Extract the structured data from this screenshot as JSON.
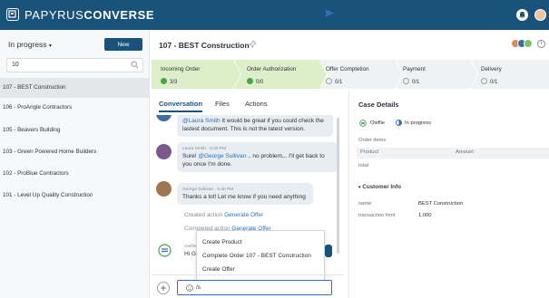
{
  "app": {
    "brand_light": "PAPYRUS",
    "brand_bold": "CONVERSE"
  },
  "colors": {
    "topbar": "#19537b",
    "accent": "#2e6fb5",
    "stage_done": "#dcefc9",
    "stage_todo": "#f0f1f2",
    "check": "#4aa54a"
  },
  "sidebar": {
    "status_filter": "In progress",
    "new_label": "New",
    "search_value": "10",
    "leads": [
      "107 - BEST Construction",
      "106 - ProAngle Contractors",
      "105 - Beavers Building",
      "103 - Green Powered Home Builders",
      "102 - ProBlue Contractors",
      "101 - Level Up Quality Construction"
    ]
  },
  "main": {
    "title": "107 - BEST Construction",
    "stages": [
      {
        "name": "Incoming Order",
        "count": "3/3",
        "done": true
      },
      {
        "name": "Order Authorization",
        "count": "0/0",
        "done": true
      },
      {
        "name": "Offer Completion",
        "count": "0/1",
        "done": false
      },
      {
        "name": "Payment",
        "count": "0/1",
        "done": false
      },
      {
        "name": "Delivery",
        "count": "0/1",
        "done": false
      }
    ],
    "tabs": [
      "Conversation",
      "Files",
      "Actions"
    ]
  },
  "conversation": {
    "msg1_cut_name": "@Laura Smith",
    "msg1_cut_rest": " It would be great if you could check the",
    "msg1_line2": "lastest document. This is not the latest version.",
    "msg2_meta": "Laura Smith · 6:40 PM",
    "msg2_pre": "Sure! ",
    "msg2_mention": "@George Sullivan",
    "msg2_post": " .. no problem,.. I'll get back to",
    "msg2_line2": "you once I'm done.",
    "msg3_meta": "George Sullivan · 6:40 PM",
    "msg3_text": "Thanks a lot! Let me know if you need anything",
    "action1_pre": "Created action ",
    "action1_link": "Generate Offer",
    "action2_pre": "Completed action ",
    "action2_link": "Generate Offer",
    "bot_meta": "Owflie",
    "bot_text": "Hi Ge"
  },
  "suggestions": [
    "Create Product",
    "Complete Order 107 - BEST Construction",
    "Create Offer"
  ],
  "composer": {
    "value": "/s"
  },
  "case": {
    "title": "Case Details",
    "owner": "Owflie",
    "status": "In progress",
    "order_items_label": "Order items",
    "col_product": "Product",
    "col_amount": "Amount",
    "total_label": "total",
    "customer_info_label": "Customer Info",
    "name_label": "name",
    "name_value": "BEST Construction",
    "limit_label": "transaction limit",
    "limit_value": "1,000"
  }
}
